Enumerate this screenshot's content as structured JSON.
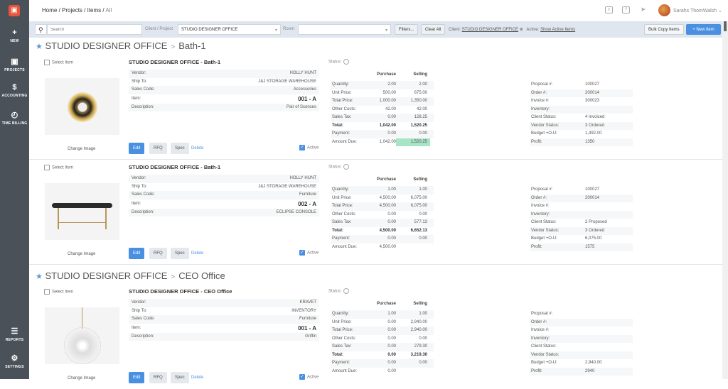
{
  "sidebar": {
    "items": [
      {
        "label": "NEW",
        "icon": "+"
      },
      {
        "label": "PROJECTS",
        "icon": "▣"
      },
      {
        "label": "ACCOUNTING",
        "icon": "$"
      },
      {
        "label": "TIME BILLING",
        "icon": "◴"
      },
      {
        "label": "REPORTS",
        "icon": "☰"
      },
      {
        "label": "SETTINGS",
        "icon": "⚙"
      }
    ]
  },
  "header": {
    "breadcrumbs": [
      "Home /",
      "Projects /",
      "Items /",
      "All"
    ],
    "user": "Sarahs ThomWalsh ⌄"
  },
  "toolbar": {
    "search_placeholder": "Search",
    "client_label": "Client / Project",
    "client_value": "STUDIO DESIGNER OFFICE",
    "room_label": "Room",
    "room_value": "",
    "filters": "Filters...",
    "clear": "Clear All",
    "client_filter_label": "Client:",
    "client_filter_value": "STUDIO DESIGNER OFFICE",
    "active_label": "Active:",
    "active_value": "Show Active Items",
    "bulk": "Bulk Copy Items",
    "new_item": "+ New Item"
  },
  "sections": [
    {
      "client": "STUDIO DESIGNER OFFICE",
      "room": "Bath-1"
    },
    {
      "client": "STUDIO DESIGNER OFFICE",
      "room": "CEO Office"
    }
  ],
  "labels": {
    "select": "Select Item",
    "change_image": "Change Image",
    "edit": "Edit",
    "rfq": "RFQ",
    "spec": "Spec",
    "delete": "Delete",
    "active": "Active",
    "status": "Status:",
    "purchase": "Purchase",
    "selling": "Selling",
    "vendor": "Vendor:",
    "ship_to": "Ship To:",
    "sales_code": "Sales Code:",
    "item": "Item:",
    "description": "Description:",
    "fin_rows": [
      "Quantity:",
      "Unit Price:",
      "Total Price:",
      "Other Costs:",
      "Sales Tax:",
      "Total:",
      "Payment:",
      "Amount Due:"
    ],
    "info_rows": [
      "Proposal #:",
      "Order #:",
      "Invoice #:",
      "Inventory:",
      "Client Status:",
      "Vendor Status:",
      "Budget +O-U:",
      "Profit:"
    ]
  },
  "items": [
    {
      "title": "STUDIO DESIGNER OFFICE - Bath-1",
      "vendor": "HOLLY HUNT",
      "ship_to": "J&J STORAGE WAREHOUSE",
      "sales_code": "Accessories",
      "item": "001 - A",
      "description": "Pair of Sconces",
      "image": "sconce",
      "purchase": [
        "2.00",
        "500.00",
        "1,000.00",
        "42.00",
        "0.00",
        "1,042.00",
        "0.00",
        "1,042.00"
      ],
      "selling": [
        "2.00",
        "675.00",
        "1,350.00",
        "42.00",
        "128.25",
        "1,520.25",
        "0.00",
        "1,520.25"
      ],
      "info": [
        "100027",
        "200014",
        "300023",
        "",
        "4 Invoiced",
        "3 Ordered",
        "1,392.00",
        "1350"
      ]
    },
    {
      "title": "STUDIO DESIGNER OFFICE - Bath-1",
      "vendor": "HOLLY HUNT",
      "ship_to": "J&J STORAGE WAREHOUSE",
      "sales_code": "Furniture",
      "item": "002 - A",
      "description": "ECLIPSE CONSOLE",
      "image": "console",
      "purchase": [
        "1.00",
        "4,500.00",
        "4,500.00",
        "0.00",
        "0.00",
        "4,500.00",
        "0.00",
        "4,500.00"
      ],
      "selling": [
        "1.00",
        "6,075.00",
        "6,075.00",
        "0.00",
        "577.13",
        "6,652.13",
        "0.00",
        ""
      ],
      "info": [
        "100027",
        "200014",
        "",
        "",
        "2 Proposed",
        "3 Ordered",
        "6,075.00",
        "1575"
      ]
    },
    {
      "title": "STUDIO DESIGNER OFFICE - CEO Office",
      "vendor": "KRAVET",
      "ship_to": "INVENTORY",
      "sales_code": "Furniture",
      "item": "001 - A",
      "description": "Griffin",
      "image": "chandelier",
      "purchase": [
        "1.00",
        "0.00",
        "0.00",
        "0.00",
        "0.00",
        "0.00",
        "0.00",
        "0.00"
      ],
      "selling": [
        "1.00",
        "2,940.00",
        "2,940.00",
        "0.00",
        "279.30",
        "3,219.30",
        "0.00",
        ""
      ],
      "info": [
        "",
        "",
        "",
        "",
        "",
        "",
        "2,940.00",
        "2940"
      ]
    }
  ]
}
